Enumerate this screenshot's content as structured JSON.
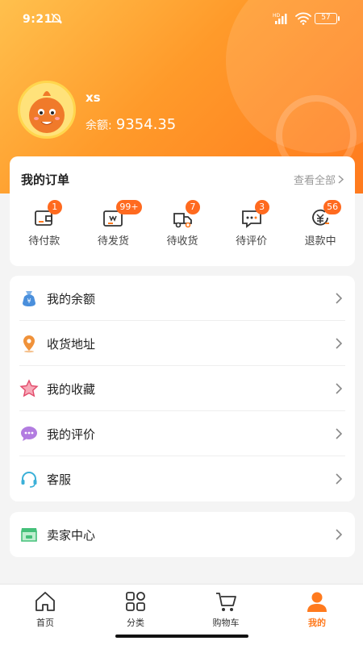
{
  "status_bar": {
    "time": "9:21",
    "battery": "57",
    "network": "HD"
  },
  "profile": {
    "username": "xs",
    "balance_label": "余额:",
    "balance_value": "9354.35"
  },
  "orders": {
    "title": "我的订单",
    "view_all": "查看全部",
    "items": [
      {
        "label": "待付款",
        "badge": "1",
        "icon": "wallet-icon"
      },
      {
        "label": "待发货",
        "badge": "99+",
        "icon": "package-icon"
      },
      {
        "label": "待收货",
        "badge": "7",
        "icon": "truck-icon"
      },
      {
        "label": "待评价",
        "badge": "3",
        "icon": "comment-icon"
      },
      {
        "label": "退款中",
        "badge": "56",
        "icon": "refund-icon"
      }
    ]
  },
  "menu": [
    {
      "label": "我的余额",
      "icon": "money-bag-icon"
    },
    {
      "label": "收货地址",
      "icon": "location-pin-icon"
    },
    {
      "label": "我的收藏",
      "icon": "star-icon"
    },
    {
      "label": "我的评价",
      "icon": "chat-bubble-icon"
    },
    {
      "label": "客服",
      "icon": "headset-icon"
    }
  ],
  "seller": {
    "label": "卖家中心",
    "icon": "store-icon"
  },
  "tabbar": [
    {
      "label": "首页",
      "icon": "home-icon"
    },
    {
      "label": "分类",
      "icon": "category-icon"
    },
    {
      "label": "购物车",
      "icon": "cart-icon"
    },
    {
      "label": "我的",
      "icon": "user-icon",
      "active": true
    }
  ],
  "colors": {
    "accent": "#ff7a1e",
    "badge": "#ff6a1f",
    "hero_start": "#ffc04d",
    "hero_end": "#ff7a1e"
  }
}
